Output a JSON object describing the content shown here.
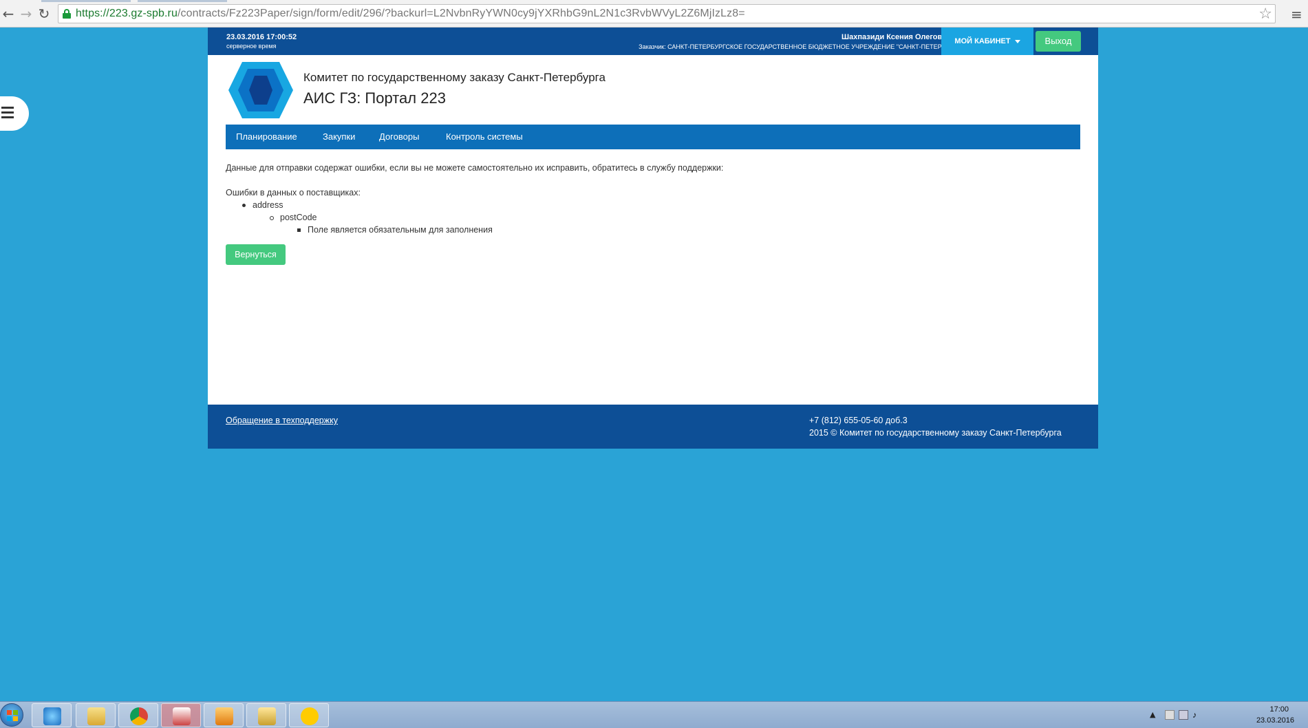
{
  "browser": {
    "url_host": "https://223.gz-spb.ru",
    "url_path": "/contracts/Fz223Paper/sign/form/edit/296/?backurl=L2NvbnRyYWN0cy9jYXRhbG9nL2N1c3RvbWVyL2Z6MjIzLz8="
  },
  "topbar": {
    "server_time": "23.03.2016 17:00:52",
    "server_time_note": "серверное время",
    "user_name": "Шахпазиди Ксения Олеговна",
    "customer": "Заказчик: САНКТ-ПЕТЕРБУРГСКОЕ ГОСУДАРСТВЕННОЕ БЮДЖЕТНОЕ УЧРЕЖДЕНИЕ \"САНКТ-ПЕТЕРБ...",
    "cabinet_label": "МОЙ КАБИНЕТ",
    "logout_label": "Выход"
  },
  "header": {
    "org_name": "Комитет по государственному заказу Санкт-Петербурга",
    "portal_name": "АИС ГЗ: Портал 223"
  },
  "nav": {
    "items": [
      "Планирование",
      "Закупки",
      "Договоры",
      "Контроль системы"
    ]
  },
  "content": {
    "message": "Данные для отправки содержат ошибки, если вы не можете самостоятельно их исправить, обратитесь в службу поддержки:",
    "errors_title": "Ошибки в данных о поставщиках:",
    "level1": "address",
    "level2": "postCode",
    "level3": "Поле является обязательным для заполнения",
    "back_label": "Вернуться"
  },
  "footer": {
    "support_link": "Обращение в техподдержку",
    "phone": "+7 (812) 655-05-60 доб.3",
    "copyright": "2015 © Комитет по государственному заказу Санкт-Петербурга"
  },
  "taskbar": {
    "time": "17:00",
    "date": "23.03.2016"
  },
  "colors": {
    "background": "#2aa3d6",
    "topbar": "#0d4f96",
    "nav": "#0d6fb9",
    "cabinet": "#1ba5e2",
    "green_button": "#44c97f"
  }
}
